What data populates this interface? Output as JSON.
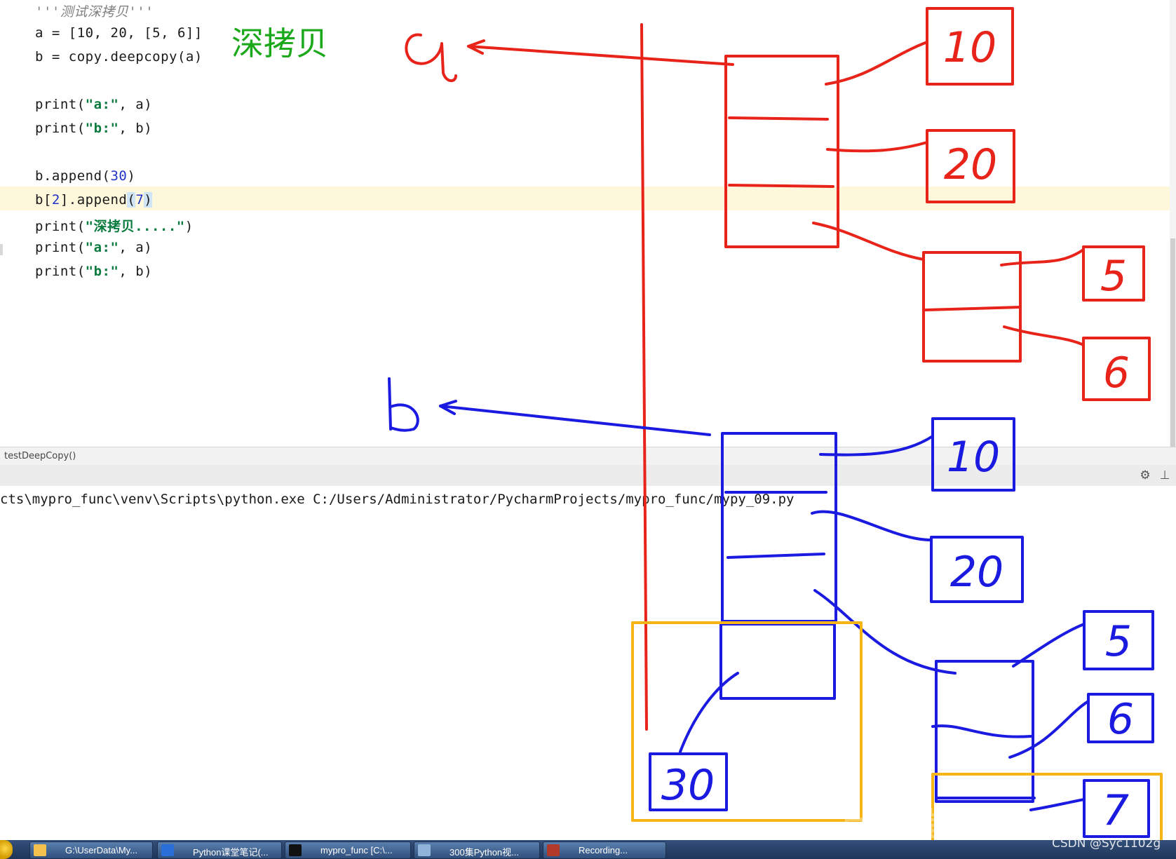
{
  "editor": {
    "lines": [
      {
        "id": "docstring",
        "text": "'''测试深拷贝'''"
      },
      {
        "id": "line-a",
        "text": "a = [10, 20, [5, 6]]"
      },
      {
        "id": "line-b",
        "text": "b = copy.deepcopy(a)"
      },
      {
        "id": "print-a-1",
        "parts": [
          "print(",
          "\"a:\"",
          ", a)"
        ]
      },
      {
        "id": "print-b-1",
        "parts": [
          "print(",
          "\"b:\"",
          ", b)"
        ]
      },
      {
        "id": "append-30",
        "parts": [
          "b.append(",
          "30",
          ")"
        ]
      },
      {
        "id": "append-7",
        "parts": [
          "b[",
          "2",
          "].append",
          "(",
          "7",
          ")"
        ]
      },
      {
        "id": "print-deep",
        "parts": [
          "print(",
          "\"深拷贝.....\"",
          ")"
        ]
      },
      {
        "id": "print-a-2",
        "parts": [
          "print(",
          "\"a:\"",
          ", a)"
        ]
      },
      {
        "id": "print-b-2",
        "parts": [
          "print(",
          "\"b:\"",
          ", b)"
        ]
      }
    ],
    "annotation_title": "深拷贝"
  },
  "breadcrumb": "testDeepCopy()",
  "run": {
    "command": "cts\\mypro_func\\venv\\Scripts\\python.exe C:/Users/Administrator/PycharmProjects/mypro_func/mypy_09.py"
  },
  "toolbar": {
    "gear_icon": "⚙",
    "pin_icon": "⊥"
  },
  "diagram": {
    "label_a": "a",
    "label_b": "b",
    "a_values": [
      "10",
      "20",
      "5",
      "6"
    ],
    "b_values": [
      "10",
      "20",
      "5",
      "6",
      "30",
      "7"
    ],
    "colors": {
      "a": "#e8231a",
      "b": "#1a1ae0",
      "highlight": "#f5b516"
    }
  },
  "taskbar": {
    "buttons": [
      {
        "label": "G:\\UserData\\My...",
        "icon": "folder-icon"
      },
      {
        "label": "Python课堂笔记(...",
        "icon": "wps-icon"
      },
      {
        "label": "mypro_func [C:\\...",
        "icon": "pycharm-icon"
      },
      {
        "label": "300集Python视...",
        "icon": "video-icon"
      },
      {
        "label": "Recording...",
        "icon": "recorder-icon"
      }
    ]
  },
  "watermark": "CSDN @Syc1102g",
  "faded_brand": "尚学堂官方"
}
